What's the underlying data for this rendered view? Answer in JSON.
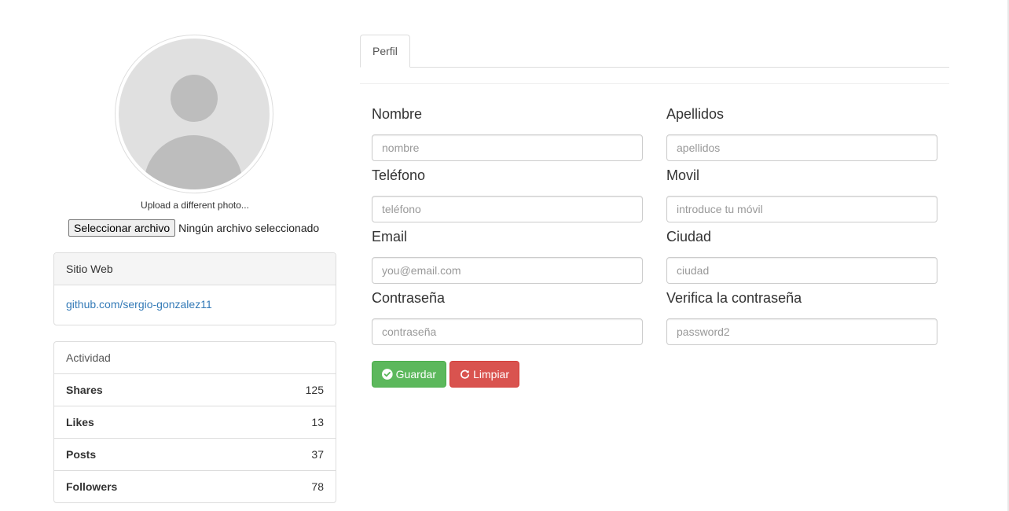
{
  "profile": {
    "upload_text": "Upload a different photo...",
    "file_button": "Seleccionar archivo",
    "file_status": "Ningún archivo seleccionado"
  },
  "website": {
    "heading": "Sitio Web",
    "link": "github.com/sergio-gonzalez11"
  },
  "activity": {
    "heading": "Actividad",
    "rows": [
      {
        "label": "Shares",
        "value": "125"
      },
      {
        "label": "Likes",
        "value": "13"
      },
      {
        "label": "Posts",
        "value": "37"
      },
      {
        "label": "Followers",
        "value": "78"
      }
    ]
  },
  "tabs": [
    {
      "label": "Perfil",
      "active": true
    }
  ],
  "form": {
    "nombre": {
      "label": "Nombre",
      "placeholder": "nombre"
    },
    "apellidos": {
      "label": "Apellidos",
      "placeholder": "apellidos"
    },
    "telefono": {
      "label": "Teléfono",
      "placeholder": "teléfono"
    },
    "movil": {
      "label": "Movil",
      "placeholder": "introduce tu móvil"
    },
    "email": {
      "label": "Email",
      "placeholder": "you@email.com"
    },
    "ciudad": {
      "label": "Ciudad",
      "placeholder": "ciudad"
    },
    "password": {
      "label": "Contraseña",
      "placeholder": "contraseña"
    },
    "password2": {
      "label": "Verifica la contraseña",
      "placeholder": "password2"
    }
  },
  "buttons": {
    "save": "Guardar",
    "clear": "Limpiar"
  },
  "colors": {
    "save": "#5cb85c",
    "clear": "#d9534f",
    "link": "#337ab7"
  },
  "icons": {
    "save": "check-circle-icon",
    "clear": "refresh-icon"
  }
}
